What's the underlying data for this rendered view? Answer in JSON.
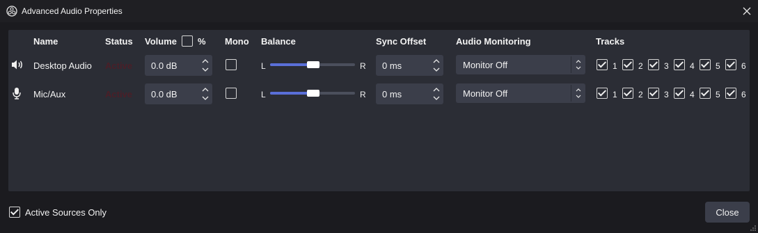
{
  "window": {
    "title": "Advanced Audio Properties"
  },
  "headers": {
    "name": "Name",
    "status": "Status",
    "volume": "Volume",
    "percent": "%",
    "mono": "Mono",
    "balance": "Balance",
    "sync_offset": "Sync Offset",
    "audio_monitoring": "Audio Monitoring",
    "tracks": "Tracks"
  },
  "sources": [
    {
      "name": "Desktop Audio",
      "icon": "speaker-icon",
      "status": "Active",
      "volume": "0.0 dB",
      "mono": false,
      "balance_left": "L",
      "balance_right": "R",
      "balance_value": 0.5,
      "sync_offset": "0 ms",
      "monitoring": "Monitor Off",
      "tracks": [
        {
          "label": "1",
          "checked": true
        },
        {
          "label": "2",
          "checked": true
        },
        {
          "label": "3",
          "checked": true
        },
        {
          "label": "4",
          "checked": true
        },
        {
          "label": "5",
          "checked": true
        },
        {
          "label": "6",
          "checked": true
        }
      ]
    },
    {
      "name": "Mic/Aux",
      "icon": "microphone-icon",
      "status": "Active",
      "volume": "0.0 dB",
      "mono": false,
      "balance_left": "L",
      "balance_right": "R",
      "balance_value": 0.5,
      "sync_offset": "0 ms",
      "monitoring": "Monitor Off",
      "tracks": [
        {
          "label": "1",
          "checked": true
        },
        {
          "label": "2",
          "checked": true
        },
        {
          "label": "3",
          "checked": true
        },
        {
          "label": "4",
          "checked": true
        },
        {
          "label": "5",
          "checked": true
        },
        {
          "label": "6",
          "checked": true
        }
      ]
    }
  ],
  "footer": {
    "active_only_label": "Active Sources Only",
    "active_only_checked": true,
    "close_label": "Close"
  },
  "colors": {
    "background": "#1b1b1f",
    "panel": "#2b2d35",
    "control": "#3b3e4a",
    "accent": "#5a6fd8",
    "status_active": "#4a1f28"
  }
}
